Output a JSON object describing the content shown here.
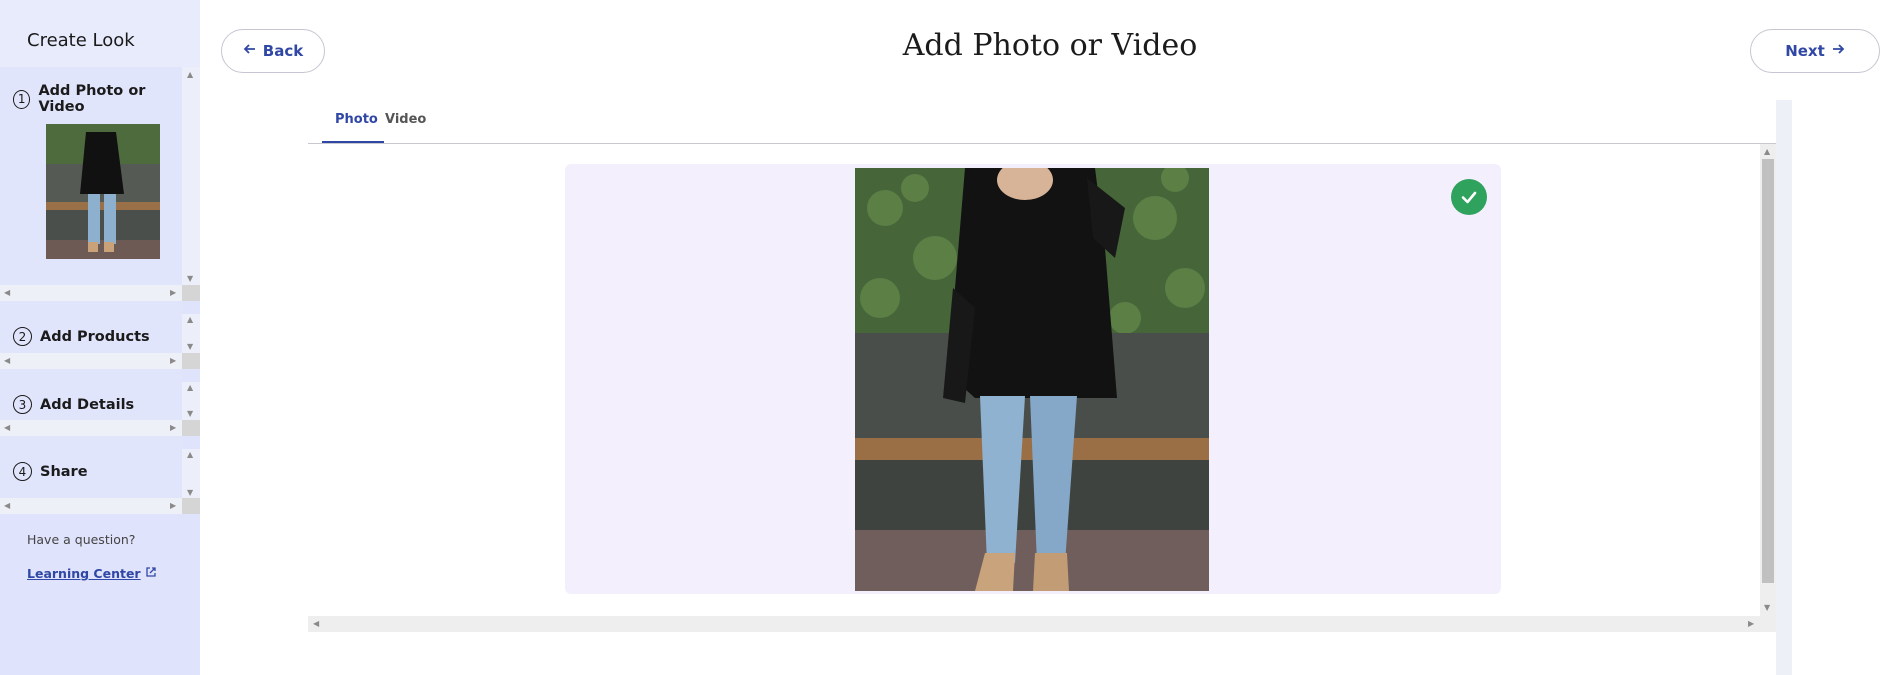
{
  "sidebar": {
    "title": "Create Look",
    "steps": [
      {
        "number": "1",
        "label": "Add Photo or Video"
      },
      {
        "number": "2",
        "label": "Add Products"
      },
      {
        "number": "3",
        "label": "Add Details"
      },
      {
        "number": "4",
        "label": "Share"
      }
    ],
    "help_text": "Have a question?",
    "learning_link": "Learning Center"
  },
  "header": {
    "back_label": "Back",
    "title": "Add Photo or Video",
    "next_label": "Next"
  },
  "tabs": [
    {
      "label": "Photo",
      "active": true
    },
    {
      "label": "Video",
      "active": false
    }
  ],
  "colors": {
    "accent": "#3147a5",
    "sidebar_bg": "#dfe3fb",
    "stage_bg": "#f4effc",
    "check": "#2fa25d"
  },
  "icons": {
    "back": "arrow-left-icon",
    "next": "arrow-right-icon",
    "selected": "check-icon",
    "external": "external-link-icon"
  }
}
